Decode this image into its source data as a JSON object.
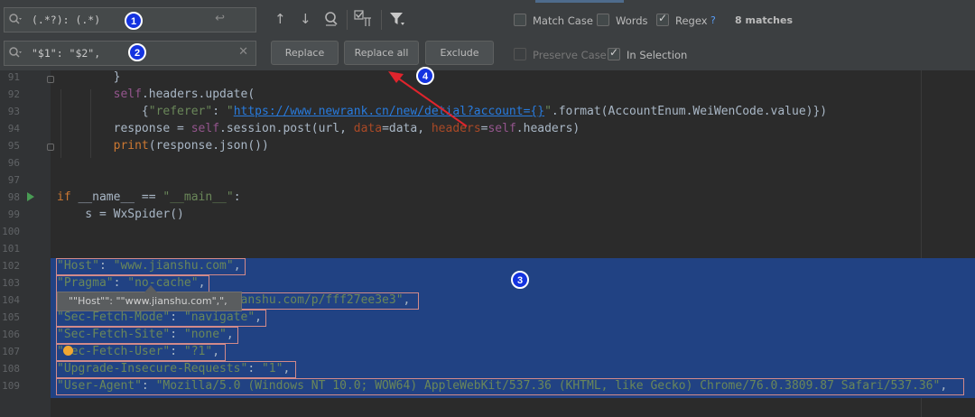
{
  "find": {
    "search_text": "(.*?): (.*)",
    "replace_text": "\"$1\": \"$2\","
  },
  "buttons": {
    "replace": "Replace",
    "replace_all": "Replace all",
    "exclude": "Exclude"
  },
  "options": {
    "match_case": {
      "label": "Match Case",
      "checked": false
    },
    "words": {
      "label": "Words",
      "checked": false
    },
    "regex": {
      "label": "Regex",
      "checked": true
    },
    "help": "?",
    "preserve_case": {
      "label": "Preserve Case",
      "checked": false
    },
    "in_selection": {
      "label": "In Selection",
      "checked": true
    },
    "matches": "8 matches"
  },
  "badges": [
    "1",
    "2",
    "3",
    "4"
  ],
  "tooltip": "\"\"Host\"\": \"\"www.jianshu.com\",\",",
  "icons": [
    "magnifier-history-icon",
    "newline-icon",
    "clear-icon",
    "arrow-up-icon",
    "arrow-down-icon",
    "find-all-icon",
    "select-occurrences-icon",
    "filter-icon",
    "run-icon",
    "bulb-icon"
  ],
  "colors": {
    "background": "#2b2b2b",
    "panel": "#3c3f41",
    "selection": "#214283",
    "keyword": "#cc7832",
    "string": "#6a8759",
    "self": "#94558d",
    "badge": "#1433e0",
    "arrow": "#e0242c"
  },
  "lines": [
    {
      "n": "91",
      "s": [
        {
          "t": "        }",
          "c": ""
        }
      ]
    },
    {
      "n": "92",
      "s": [
        {
          "t": "        ",
          "c": ""
        },
        {
          "t": "self",
          "c": "self"
        },
        {
          "t": ".headers.update(",
          "c": ""
        }
      ]
    },
    {
      "n": "93",
      "s": [
        {
          "t": "            {",
          "c": ""
        },
        {
          "t": "\"referer\"",
          "c": "str"
        },
        {
          "t": ": ",
          "c": ""
        },
        {
          "t": "\"",
          "c": "str"
        },
        {
          "t": "https://www.newrank.cn/new/detial?account={}",
          "c": "url"
        },
        {
          "t": "\"",
          "c": "str"
        },
        {
          "t": ".format(AccountEnum.WeiWenCode.value)})",
          "c": ""
        }
      ]
    },
    {
      "n": "94",
      "s": [
        {
          "t": "        response = ",
          "c": ""
        },
        {
          "t": "self",
          "c": "self"
        },
        {
          "t": ".session.post(url, ",
          "c": ""
        },
        {
          "t": "data",
          "c": "kwa"
        },
        {
          "t": "=data, ",
          "c": ""
        },
        {
          "t": "headers",
          "c": "kwa"
        },
        {
          "t": "=",
          "c": ""
        },
        {
          "t": "self",
          "c": "self"
        },
        {
          "t": ".headers)",
          "c": ""
        }
      ]
    },
    {
      "n": "95",
      "s": [
        {
          "t": "        ",
          "c": ""
        },
        {
          "t": "print",
          "c": "kw"
        },
        {
          "t": "(response.json())",
          "c": ""
        }
      ]
    },
    {
      "n": "96",
      "s": []
    },
    {
      "n": "97",
      "s": []
    },
    {
      "n": "98",
      "s": [
        {
          "t": "if",
          "c": "kw"
        },
        {
          "t": " __name__ == ",
          "c": ""
        },
        {
          "t": "\"__main__\"",
          "c": "str"
        },
        {
          "t": ":",
          "c": ""
        }
      ]
    },
    {
      "n": "99",
      "s": [
        {
          "t": "    s = WxSpider()",
          "c": ""
        }
      ]
    },
    {
      "n": "100",
      "s": []
    },
    {
      "n": "101",
      "s": []
    },
    {
      "n": "102",
      "s": [
        {
          "t": "\"Host\"",
          "c": "str"
        },
        {
          "t": ": ",
          "c": ""
        },
        {
          "t": "\"www.jianshu.com\"",
          "c": "str"
        },
        {
          "t": ",",
          "c": ""
        }
      ]
    },
    {
      "n": "103",
      "s": [
        {
          "t": "\"Pragma\"",
          "c": "str"
        },
        {
          "t": ": ",
          "c": ""
        },
        {
          "t": "\"no-cache\"",
          "c": "str"
        },
        {
          "t": ",",
          "c": ""
        }
      ]
    },
    {
      "n": "104",
      "s": [
        {
          "t": "\"Referer\"",
          "c": "str"
        },
        {
          "t": ": ",
          "c": ""
        },
        {
          "t": "\"https://www.jianshu.com/p/fff27ee3e3\"",
          "c": "str"
        },
        {
          "t": ",",
          "c": ""
        }
      ]
    },
    {
      "n": "105",
      "s": [
        {
          "t": "\"Sec-Fetch-Mode\"",
          "c": "str"
        },
        {
          "t": ": ",
          "c": ""
        },
        {
          "t": "\"navigate\"",
          "c": "str"
        },
        {
          "t": ",",
          "c": ""
        }
      ]
    },
    {
      "n": "106",
      "s": [
        {
          "t": "\"Sec-Fetch-Site\"",
          "c": "str"
        },
        {
          "t": ": ",
          "c": ""
        },
        {
          "t": "\"none\"",
          "c": "str"
        },
        {
          "t": ",",
          "c": ""
        }
      ]
    },
    {
      "n": "107",
      "s": [
        {
          "t": "\"Sec-Fetch-User\"",
          "c": "str"
        },
        {
          "t": ": ",
          "c": ""
        },
        {
          "t": "\"?1\"",
          "c": "str"
        },
        {
          "t": ",",
          "c": ""
        }
      ]
    },
    {
      "n": "108",
      "s": [
        {
          "t": "\"Upgrade-Insecure-Requests\"",
          "c": "str"
        },
        {
          "t": ": ",
          "c": ""
        },
        {
          "t": "\"1\"",
          "c": "str"
        },
        {
          "t": ",",
          "c": ""
        }
      ]
    },
    {
      "n": "109",
      "s": [
        {
          "t": "\"User-Agent\"",
          "c": "str"
        },
        {
          "t": ": ",
          "c": ""
        },
        {
          "t": "\"Mozilla/5.0 (Windows NT 10.0; WOW64) AppleWebKit/537.36 (KHTML, like Gecko) Chrome/76.0.3809.87 Safari/537.36\"",
          "c": "str"
        },
        {
          "t": ",",
          "c": ""
        }
      ]
    }
  ]
}
